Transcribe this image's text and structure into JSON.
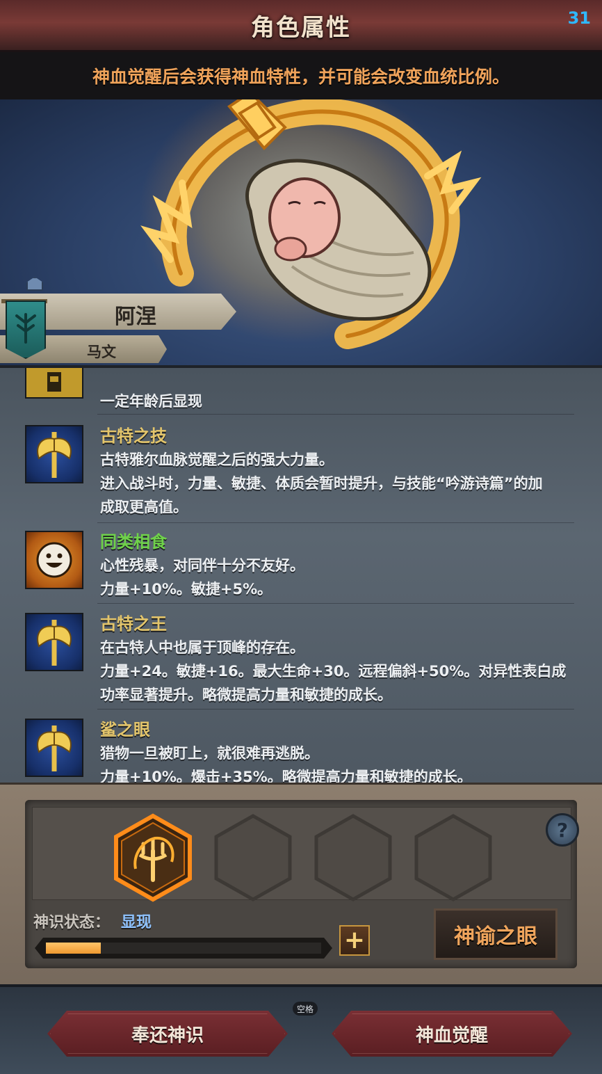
{
  "header": {
    "title": "角色属性",
    "fps": "31"
  },
  "notice": "神血觉醒后会获得神血特性，并可能会改变血统比例。",
  "character": {
    "name": "阿涅",
    "title": "马文"
  },
  "traits": [
    {
      "name": "",
      "icon": "tower-icon",
      "lines": [
        "一定年龄后显现"
      ]
    },
    {
      "name": "古特之技",
      "name_color": "#e3c56b",
      "icon": "golden-axe-icon",
      "lines": [
        "古特雅尔血脉觉醒之后的强大力量。",
        "进入战斗时，力量、敏捷、体质会暂时提升，与技能“吟游诗篇”的加",
        "成取更高值。"
      ]
    },
    {
      "name": "同类相食",
      "name_color": "#6fd24a",
      "icon": "smiley-face-icon",
      "lines": [
        "心性残暴，对同伴十分不友好。",
        "力量+10%。敏捷+5%。"
      ]
    },
    {
      "name": "古特之王",
      "name_color": "#e3c56b",
      "icon": "golden-axe-icon",
      "lines": [
        "在古特人中也属于顶峰的存在。",
        "力量+24。敏捷+16。最大生命+30。远程偏斜+50%。对异性表白成",
        "功率显著提升。略微提高力量和敏捷的成长。"
      ]
    },
    {
      "name": "鲨之眼",
      "name_color": "#e3c56b",
      "icon": "golden-axe-icon",
      "lines": [
        "猎物一旦被盯上，就很难再逃脱。",
        "力量+10%。爆击+35%。略微提高力量和敏捷的成长。"
      ]
    }
  ],
  "divine": {
    "slots": [
      {
        "filled": true,
        "icon": "flaming-trident-icon"
      },
      {
        "filled": false
      },
      {
        "filled": false
      },
      {
        "filled": false
      }
    ],
    "help": "?",
    "status_label": "神识状态：",
    "status_value": "显现",
    "progress": 0.2,
    "plus": "+",
    "oracle_button": "神谕之眼"
  },
  "footer": {
    "left_button": "奉还神识",
    "right_button": "神血觉醒",
    "key_hint": "空格"
  }
}
